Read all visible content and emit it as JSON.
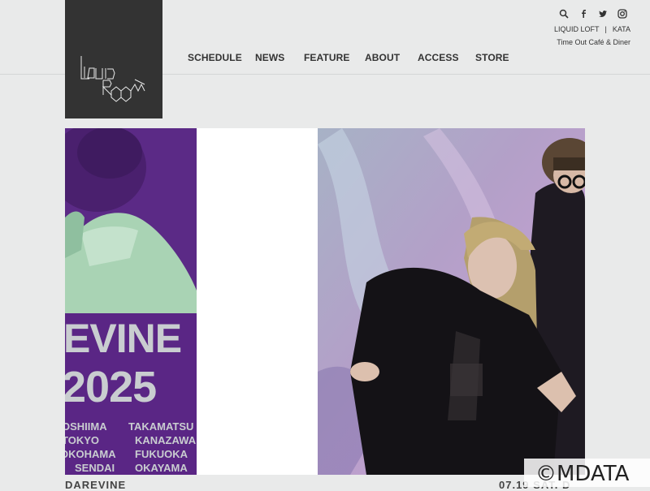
{
  "header": {
    "logo_alt": "LIQUIDROOM",
    "nav": [
      {
        "label": "SCHEDULE"
      },
      {
        "label": "NEWS"
      },
      {
        "label": "FEATURE"
      },
      {
        "label": "ABOUT"
      },
      {
        "label": "ACCESS"
      },
      {
        "label": "STORE"
      }
    ],
    "icons": [
      "search-icon",
      "facebook-icon",
      "twitter-icon",
      "instagram-icon"
    ],
    "liquid_loft": "LIQUID LOFT",
    "separator": "|",
    "kata": "KATA",
    "time_out": "Time Out Café & Diner"
  },
  "slides": {
    "poster": {
      "title": "EVINE",
      "year": "2025",
      "cities": [
        "OSHIIMA",
        "TAKAMATSU",
        "TOKYO",
        "KANAZAWA",
        "OKOHAMA",
        "FUKUOKA",
        "SENDAI",
        "OKAYAMA"
      ]
    }
  },
  "caption": {
    "left": "DAREVINE",
    "right": "07.19 SAT. D"
  },
  "watermark": "©MDATA",
  "colors": {
    "background": "#e9eaea",
    "logo_bg": "#333333",
    "poster_purple": "#5b2a86"
  }
}
